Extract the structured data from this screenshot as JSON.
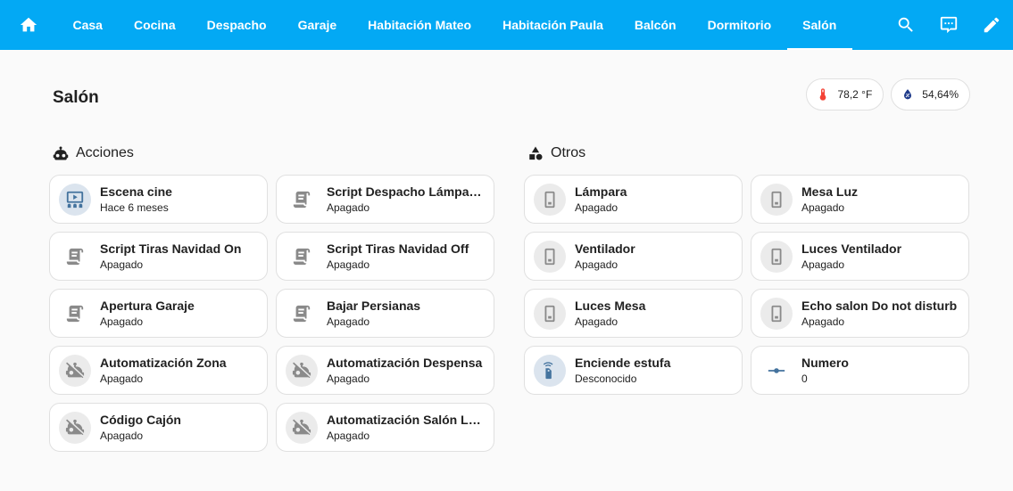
{
  "header": {
    "tabs": [
      {
        "label": "Casa"
      },
      {
        "label": "Cocina"
      },
      {
        "label": "Despacho"
      },
      {
        "label": "Garaje"
      },
      {
        "label": "Habitación Mateo"
      },
      {
        "label": "Habitación Paula"
      },
      {
        "label": "Balcón"
      },
      {
        "label": "Dormitorio"
      },
      {
        "label": "Salón"
      }
    ],
    "active_tab": "Salón",
    "icons": {
      "home": "home-icon",
      "search": "search-icon",
      "assist": "assist-chat-icon",
      "edit": "pencil-icon"
    }
  },
  "view": {
    "title": "Salón",
    "badges": [
      {
        "value": "78,2 °F",
        "icon": "thermometer-icon",
        "color": "#f44336"
      },
      {
        "value": "54,64%",
        "icon": "water-percent-icon",
        "color": "#1e3a8a"
      }
    ]
  },
  "sections": [
    {
      "title": "Acciones",
      "icon": "robot-icon",
      "tiles": [
        {
          "name": "Escena cine",
          "state": "Hace 6 meses",
          "icon": "scene-theater-icon"
        },
        {
          "name": "Script Despacho Lámpara ...",
          "state": "Apagado",
          "icon": "script-text-icon"
        },
        {
          "name": "Script Tiras Navidad On",
          "state": "Apagado",
          "icon": "script-text-icon"
        },
        {
          "name": "Script Tiras Navidad Off",
          "state": "Apagado",
          "icon": "script-text-icon"
        },
        {
          "name": "Apertura Garaje",
          "state": "Apagado",
          "icon": "script-text-icon"
        },
        {
          "name": "Bajar Persianas",
          "state": "Apagado",
          "icon": "script-text-icon"
        },
        {
          "name": "Automatización Zona",
          "state": "Apagado",
          "icon": "robot-off-icon"
        },
        {
          "name": "Automatización Despensa",
          "state": "Apagado",
          "icon": "robot-off-icon"
        },
        {
          "name": "Código Cajón",
          "state": "Apagado",
          "icon": "robot-off-icon"
        },
        {
          "name": "Automatización Salón Lá...",
          "state": "Apagado",
          "icon": "robot-off-icon"
        }
      ]
    },
    {
      "title": "Otros",
      "icon": "shape-icon",
      "tiles": [
        {
          "name": "Lámpara",
          "state": "Apagado",
          "icon": "light-switch-icon"
        },
        {
          "name": "Mesa Luz",
          "state": "Apagado",
          "icon": "light-switch-icon"
        },
        {
          "name": "Ventilador",
          "state": "Apagado",
          "icon": "light-switch-icon"
        },
        {
          "name": "Luces Ventilador",
          "state": "Apagado",
          "icon": "light-switch-icon"
        },
        {
          "name": "Luces Mesa",
          "state": "Apagado",
          "icon": "light-switch-icon"
        },
        {
          "name": "Echo salon Do not disturb",
          "state": "Apagado",
          "icon": "light-switch-icon"
        },
        {
          "name": "Enciende estufa",
          "state": "Desconocido",
          "icon": "remote-ir-icon"
        },
        {
          "name": "Numero",
          "state": "0",
          "icon": "ray-vertex-icon"
        }
      ]
    }
  ],
  "colors": {
    "header": "#03a9f4",
    "icon_gray": "#8a8a8a",
    "icon_blue": "#44739e"
  }
}
